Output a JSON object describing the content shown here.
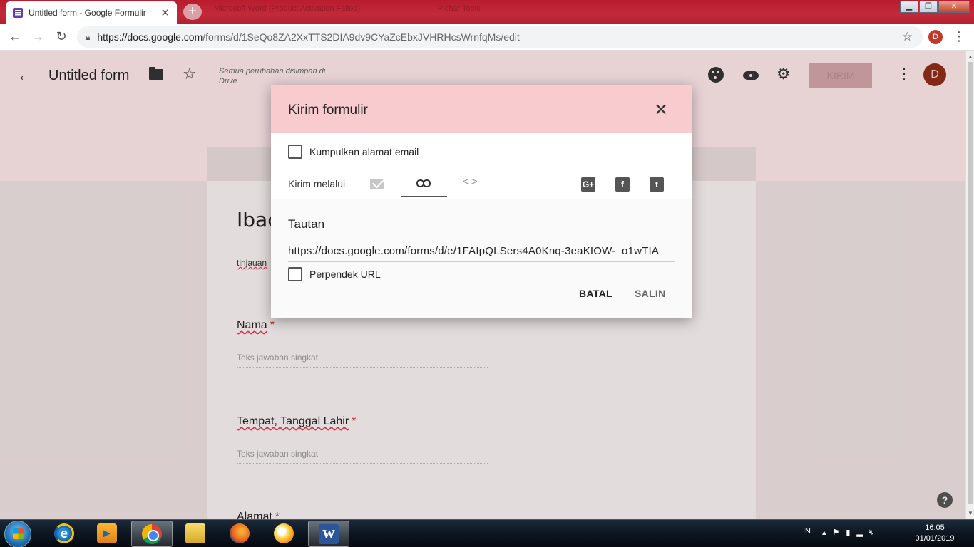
{
  "browser": {
    "tab_title": "Untitled form - Google Formulir",
    "tab_close": "✕",
    "new_tab": "+",
    "background_tab_text": "Microsoft Word (Product Activation Failed)",
    "background_tab_text2": "Pichar Tools",
    "url_host": "https://docs.google.com",
    "url_path": "/forms/d/1SeQo8ZA2XxTTS2DIA9dv9CYaZcEbxJVHRHcsWrnfqMs/edit",
    "profile_initial": "D"
  },
  "forms_header": {
    "title": "Untitled form",
    "saved_status": "Semua perubahan disimpan di Drive",
    "send_label": "KIRIM",
    "avatar_initial": "D"
  },
  "form": {
    "title_partial": "Ibad",
    "description_partial": "tinjauan",
    "questions": [
      {
        "label": "Nama",
        "required": "*",
        "placeholder": "Teks jawaban singkat"
      },
      {
        "label": "Tempat, Tanggal Lahir",
        "required": "*",
        "placeholder": "Teks jawaban singkat"
      },
      {
        "label": "Alamat",
        "required": "*"
      }
    ]
  },
  "modal": {
    "title": "Kirim formulir",
    "collect_email_label": "Kumpulkan alamat email",
    "send_via_label": "Kirim melalui",
    "section_title": "Tautan",
    "link_url": "https://docs.google.com/forms/d/e/1FAIpQLSers4A0Knq-3eaKIOW-_o1wTIA",
    "shorten_url_label": "Perpendek URL",
    "cancel_label": "BATAL",
    "copy_label": "SALIN",
    "code_icon_text": "<>",
    "gplus_text": "G+",
    "facebook_text": "f",
    "twitter_text": "t"
  },
  "taskbar": {
    "language": "IN",
    "time": "16:05",
    "date": "01/01/2019",
    "word_letter": "W",
    "ie_letter": "e"
  },
  "colors": {
    "modal_header": "#f8cccf",
    "forms_band": "#fbe4e6",
    "chrome_tabstrip": "#b81c2e",
    "required_star": "#d93025"
  }
}
